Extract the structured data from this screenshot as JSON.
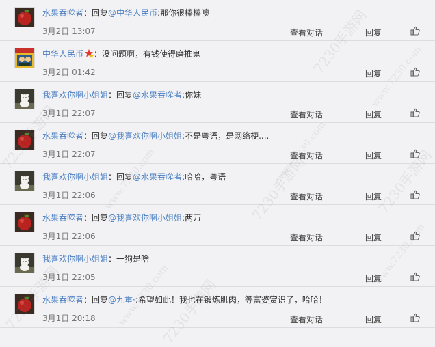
{
  "comments": [
    {
      "user": "水果吞噬者",
      "avatar": "apple",
      "badge": false,
      "prefix": "：回复",
      "mention": "@中华人民币",
      "suffix": ":那你很棒棒噢",
      "time": "3月2日 13:07",
      "view_label": "查看对话",
      "reply_label": "回复"
    },
    {
      "user": "中华人民币",
      "avatar": "poster",
      "badge": true,
      "prefix": "：没问题啊，有钱使得磨推鬼",
      "mention": "",
      "suffix": "",
      "time": "3月2日 01:42",
      "view_label": "",
      "reply_label": "回复"
    },
    {
      "user": "我喜欢你啊小姐姐",
      "avatar": "bear",
      "badge": false,
      "prefix": "：回复",
      "mention": "@水果吞噬者",
      "suffix": ":你妹",
      "time": "3月1日 22:07",
      "view_label": "查看对话",
      "reply_label": "回复"
    },
    {
      "user": "水果吞噬者",
      "avatar": "apple",
      "badge": false,
      "prefix": "：回复",
      "mention": "@我喜欢你啊小姐姐",
      "suffix": ":不是粤语，是网络梗....",
      "time": "3月1日 22:07",
      "view_label": "查看对话",
      "reply_label": "回复"
    },
    {
      "user": "我喜欢你啊小姐姐",
      "avatar": "bear",
      "badge": false,
      "prefix": "：回复",
      "mention": "@水果吞噬者",
      "suffix": ":哈哈，粤语",
      "time": "3月1日 22:06",
      "view_label": "查看对话",
      "reply_label": "回复"
    },
    {
      "user": "水果吞噬者",
      "avatar": "apple",
      "badge": false,
      "prefix": "：回复",
      "mention": "@我喜欢你啊小姐姐",
      "suffix": ":两万",
      "time": "3月1日 22:06",
      "view_label": "查看对话",
      "reply_label": "回复"
    },
    {
      "user": "我喜欢你啊小姐姐",
      "avatar": "bear",
      "badge": false,
      "prefix": "：一狗是啥",
      "mention": "",
      "suffix": "",
      "time": "3月1日 22:05",
      "view_label": "",
      "reply_label": "回复"
    },
    {
      "user": "水果吞噬者",
      "avatar": "apple",
      "badge": false,
      "prefix": "：回复",
      "mention": "@九重·",
      "suffix": ":希望如此！我也在锻炼肌肉，等富婆赏识了，哈哈！",
      "time": "3月1日 20:18",
      "view_label": "查看对话",
      "reply_label": "回复"
    }
  ],
  "watermark": {
    "text1": "7230手游网",
    "text2": "www.7230.com"
  }
}
